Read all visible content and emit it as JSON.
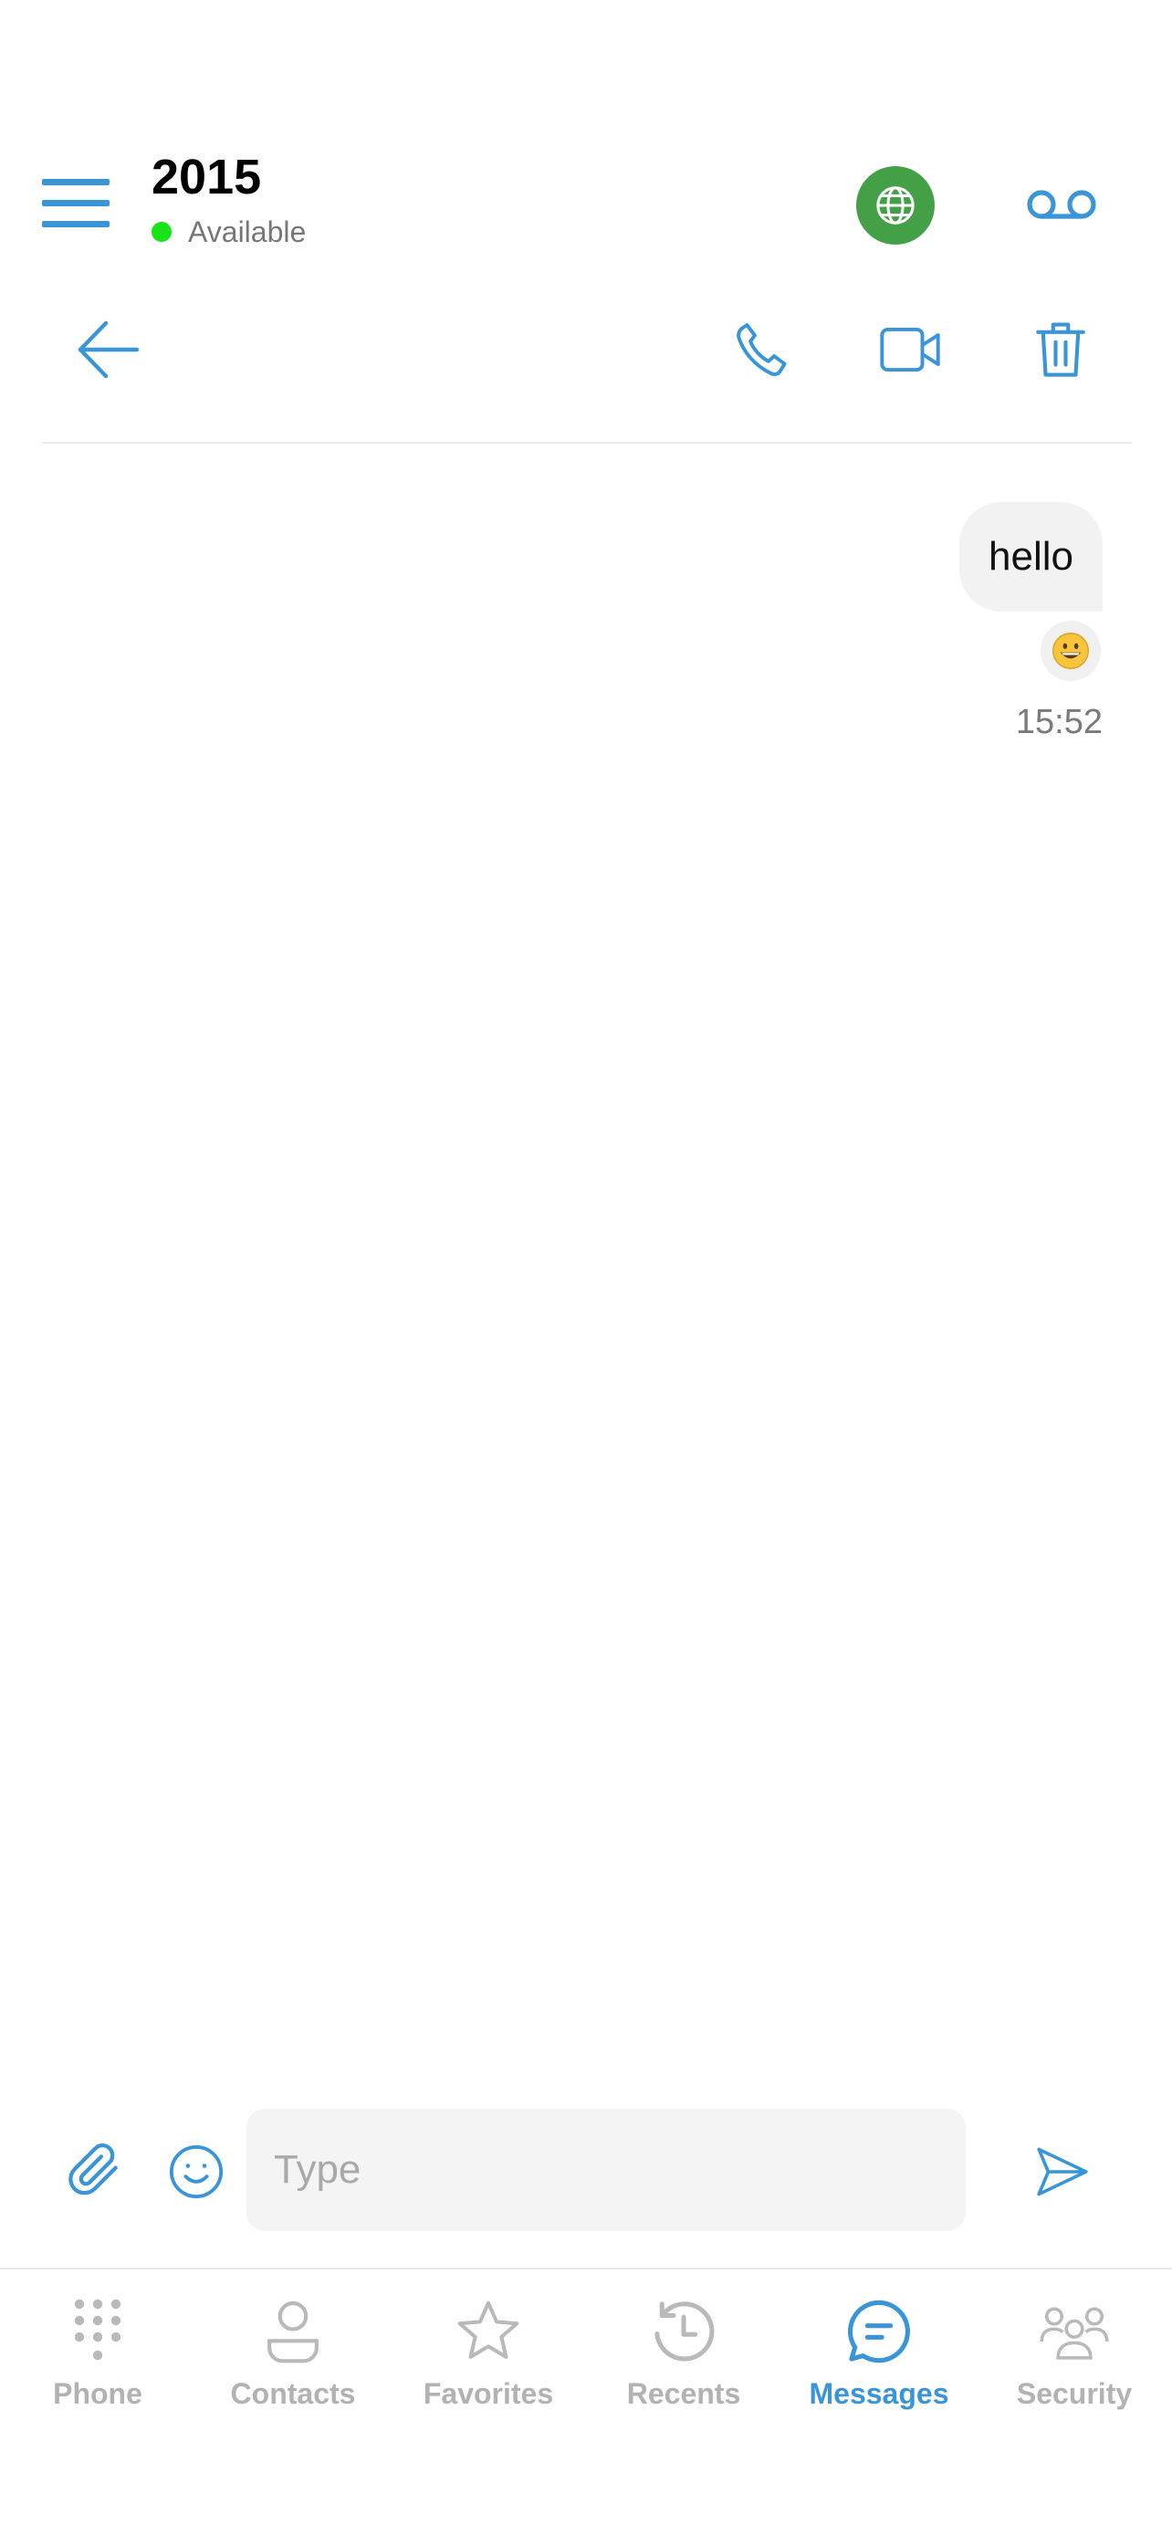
{
  "header": {
    "title": "2015",
    "status_text": "Available",
    "status_color": "#18e218",
    "globe_icon": "globe-icon",
    "voicemail_icon": "voicemail-icon"
  },
  "action_bar": {
    "back_icon": "arrow-left-icon",
    "call_icon": "phone-icon",
    "video_icon": "video-camera-icon",
    "delete_icon": "trash-icon"
  },
  "messages": [
    {
      "text": "hello",
      "direction": "outgoing",
      "reaction": "😀",
      "time": "15:52"
    }
  ],
  "composer": {
    "placeholder": "Type",
    "value": ""
  },
  "tabs": [
    {
      "label": "Phone",
      "icon": "dialpad-icon",
      "active": false
    },
    {
      "label": "Contacts",
      "icon": "person-icon",
      "active": false
    },
    {
      "label": "Favorites",
      "icon": "star-icon",
      "active": false
    },
    {
      "label": "Recents",
      "icon": "history-icon",
      "active": false
    },
    {
      "label": "Messages",
      "icon": "chat-bubble-icon",
      "active": true
    },
    {
      "label": "Security",
      "icon": "group-icon",
      "active": false
    }
  ],
  "colors": {
    "accent": "#3a95d8",
    "globe_bg": "#43a047",
    "inactive_tab": "#b2b2b2",
    "bubble_bg": "#f2f2f2"
  }
}
